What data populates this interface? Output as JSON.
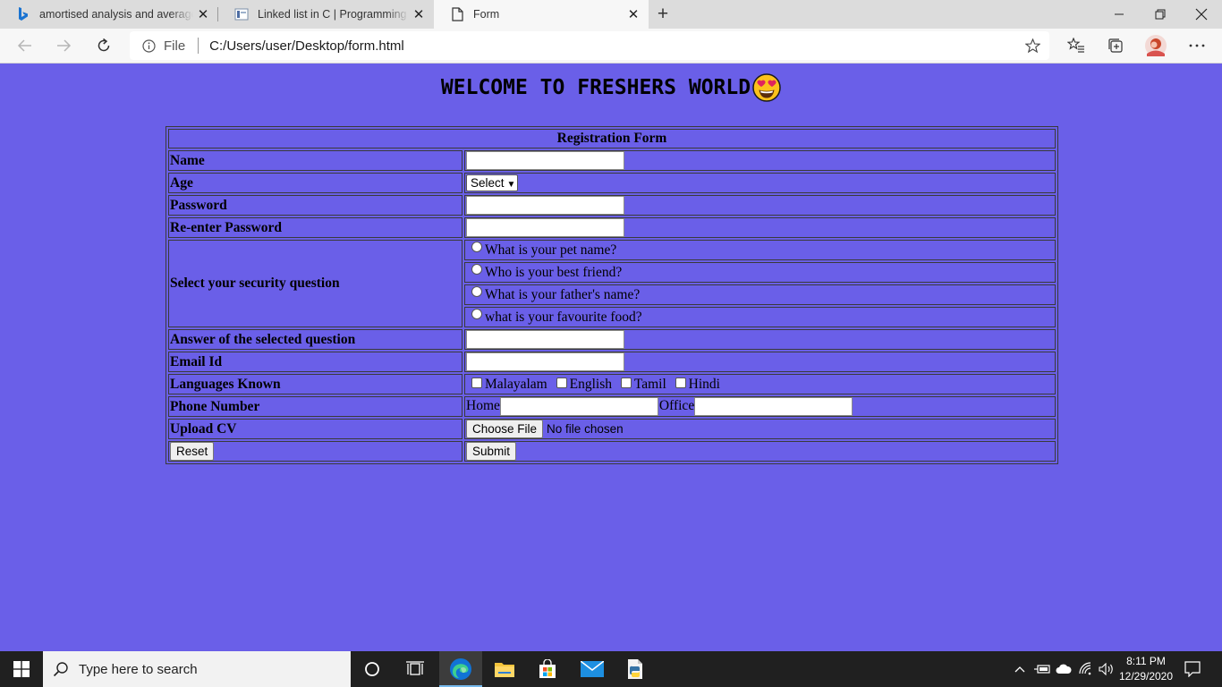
{
  "browser": {
    "tabs": [
      {
        "title": "amortised analysis and average c",
        "favicon": "bing-icon"
      },
      {
        "title": "Linked list in C | Programming S",
        "favicon": "site-icon"
      },
      {
        "title": "Form",
        "favicon": "page-icon",
        "active": true
      }
    ],
    "address": {
      "scheme": "File",
      "url": "C:/Users/user/Desktop/form.html"
    }
  },
  "page": {
    "heading": "WELCOME TO FRESHERS WORLD",
    "form": {
      "caption": "Registration Form",
      "name_label": "Name",
      "age_label": "Age",
      "age_select_value": "Select",
      "password_label": "Password",
      "reenter_label": "Re-enter Password",
      "security_label": "Select your security question",
      "questions": [
        "What is your pet name?",
        "Who is your best friend?",
        "What is your father's name?",
        "what is your favourite food?"
      ],
      "answer_label": "Answer of the selected question",
      "email_label": "Email Id",
      "languages_label": "Languages Known",
      "languages": [
        "Malayalam",
        "English",
        "Tamil",
        "Hindi"
      ],
      "phone_label": "Phone Number",
      "phone_home": "Home",
      "phone_office": "Office",
      "cv_label": "Upload CV",
      "choose_file": "Choose File",
      "no_file": "No file chosen",
      "reset": "Reset",
      "submit": "Submit"
    }
  },
  "taskbar": {
    "search_placeholder": "Type here to search",
    "time": "8:11 PM",
    "date": "12/29/2020"
  },
  "colors": {
    "page_background": "#6a5fe8",
    "taskbar": "#202020",
    "accent": "#76b9ed"
  }
}
